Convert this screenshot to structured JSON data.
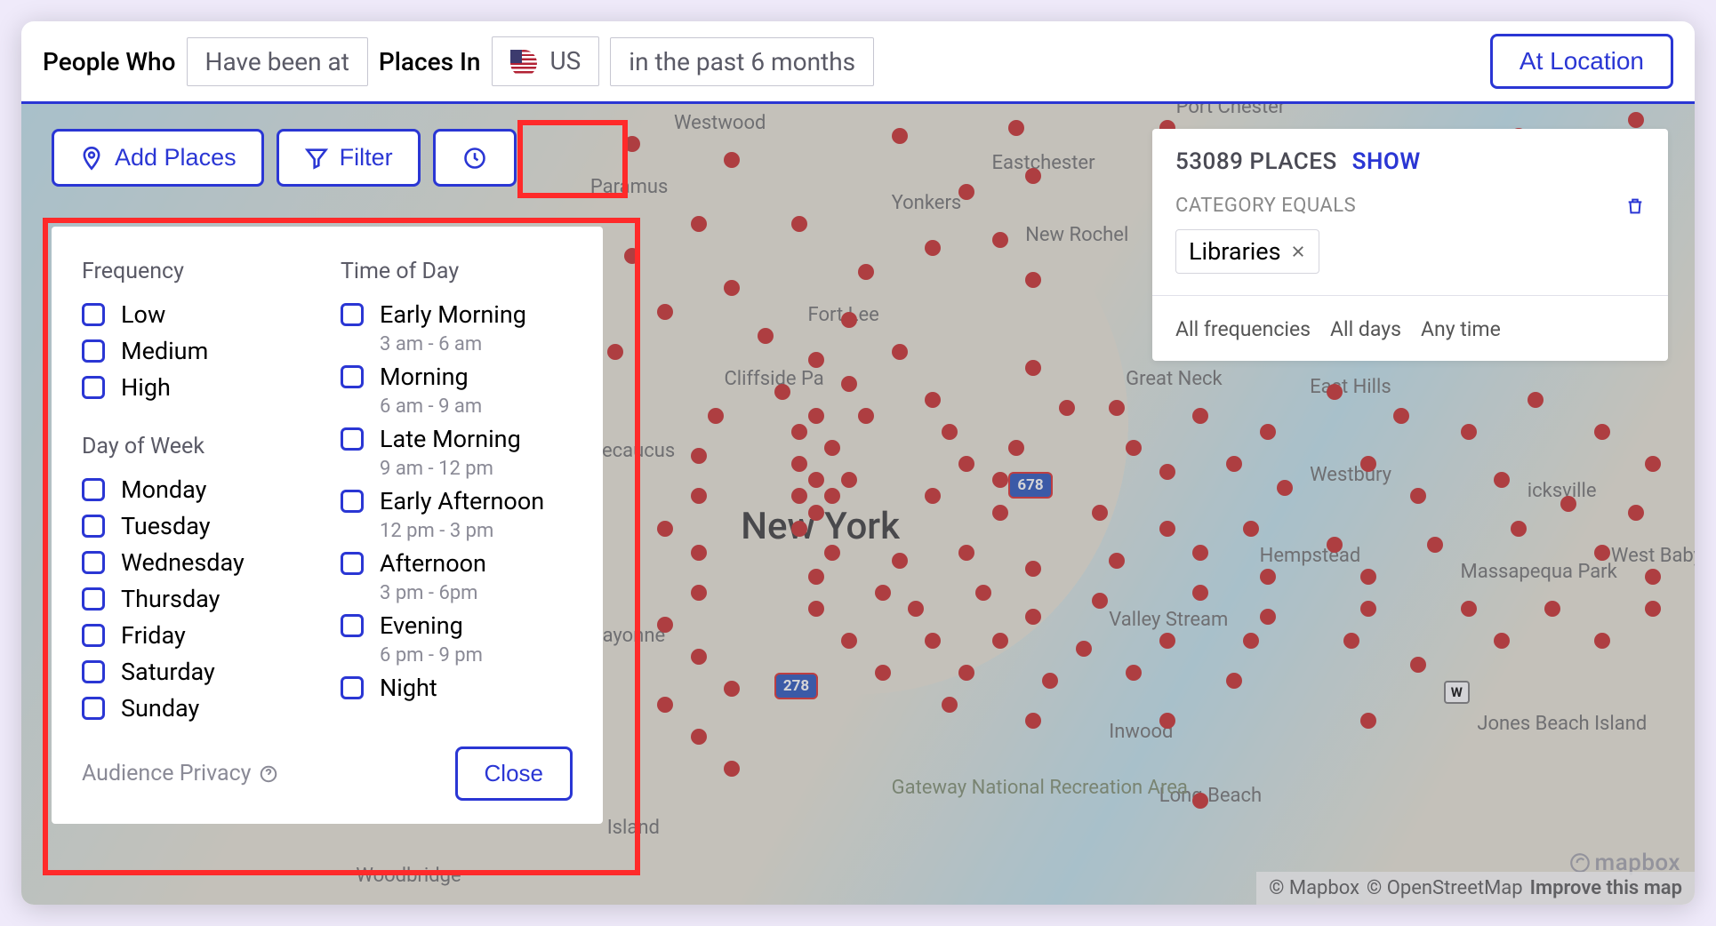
{
  "header": {
    "title": "People Who",
    "dropdown1": "Have been at",
    "places_label": "Places In",
    "country": "US",
    "timeframe": "in the past 6 months",
    "at_location": "At Location"
  },
  "toolbar": {
    "add_places": "Add Places",
    "filter": "Filter"
  },
  "popup": {
    "frequency_title": "Frequency",
    "frequency": [
      "Low",
      "Medium",
      "High"
    ],
    "day_title": "Day of Week",
    "days": [
      "Monday",
      "Tuesday",
      "Wednesday",
      "Thursday",
      "Friday",
      "Saturday",
      "Sunday"
    ],
    "tod_title": "Time of Day",
    "times": [
      {
        "label": "Early Morning",
        "sub": "3 am - 6 am"
      },
      {
        "label": "Morning",
        "sub": "6 am - 9 am"
      },
      {
        "label": "Late Morning",
        "sub": "9 am - 12 pm"
      },
      {
        "label": "Early Afternoon",
        "sub": "12 pm - 3 pm"
      },
      {
        "label": "Afternoon",
        "sub": "3 pm - 6pm"
      },
      {
        "label": "Evening",
        "sub": "6 pm - 9 pm"
      },
      {
        "label": "Night",
        "sub": ""
      }
    ],
    "privacy": "Audience Privacy",
    "close": "Close"
  },
  "info": {
    "count": "53089 PLACES",
    "show": "SHOW",
    "cat_label": "CATEGORY EQUALS",
    "chip": "Libraries",
    "f1": "All frequencies",
    "f2": "All days",
    "f3": "Any time"
  },
  "map_labels": {
    "ny": "New York",
    "yonkers": "Yonkers",
    "westwood": "Westwood",
    "paramus": "Paramus",
    "newroch": "New Rochel",
    "fortlee": "Fort Lee",
    "cliffside": "Cliffside Pa",
    "secaucus": "Secaucus",
    "eastchester": "Eastchester",
    "greatneck": "Great Neck",
    "easthills": "East Hills",
    "westbury": "Westbury",
    "hicksville": "icksville",
    "hempstead": "Hempstead",
    "massapequa": "Massapequa Park",
    "westbabyl": "West Babyl",
    "jonesbeach": "Jones Beach Island",
    "inwood": "Inwood",
    "longbeach": "Long Beach",
    "valleystream": "Valley Stream",
    "bayonne": "Bayonne",
    "gateway": "Gateway National Recreation Area",
    "woodbridge": "Woodbridge",
    "island": "Island",
    "portchester": "Port Chester",
    "shield1": "678",
    "shield2": "278",
    "badge_w": "W"
  },
  "attribution": {
    "mapbox": "© Mapbox",
    "osm": "© OpenStreetMap",
    "improve": "Improve this map",
    "logo": "mapbox"
  }
}
